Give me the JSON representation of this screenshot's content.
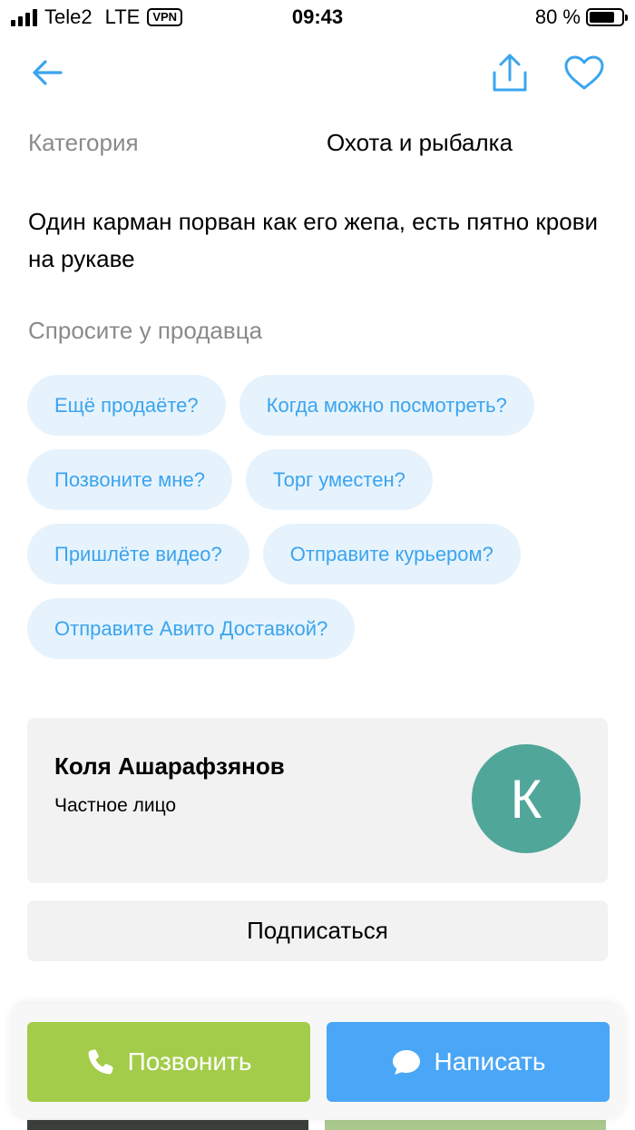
{
  "status_bar": {
    "carrier": "Tele2",
    "network": "LTE",
    "vpn": "VPN",
    "time": "09:43",
    "battery_percent": "80 %",
    "battery_level": 0.8
  },
  "nav": {
    "icons": [
      "back-arrow-icon",
      "share-icon",
      "heart-icon"
    ],
    "accent_color": "#3ba4ee"
  },
  "details": {
    "category_label": "Категория",
    "category_value": "Охота и рыбалка",
    "description": "Один карман порван как его жепа, есть пятно крови на рукаве"
  },
  "ask_seller": {
    "title": "Спросите у продавца",
    "questions": [
      "Ещё продаёте?",
      "Когда можно посмотреть?",
      "Позвоните мне?",
      "Торг уместен?",
      "Пришлёте видео?",
      "Отправите курьером?",
      "Отправите Авито Доставкой?"
    ]
  },
  "seller": {
    "name": "Коля Ашарафзянов",
    "type": "Частное лицо",
    "avatar_letter": "К",
    "avatar_color": "#51a69a"
  },
  "subscribe_label": "Подписаться",
  "actions": {
    "call_label": "Позвонить",
    "call_color": "#a3cc4a",
    "write_label": "Написать",
    "write_color": "#4aa6f6"
  }
}
